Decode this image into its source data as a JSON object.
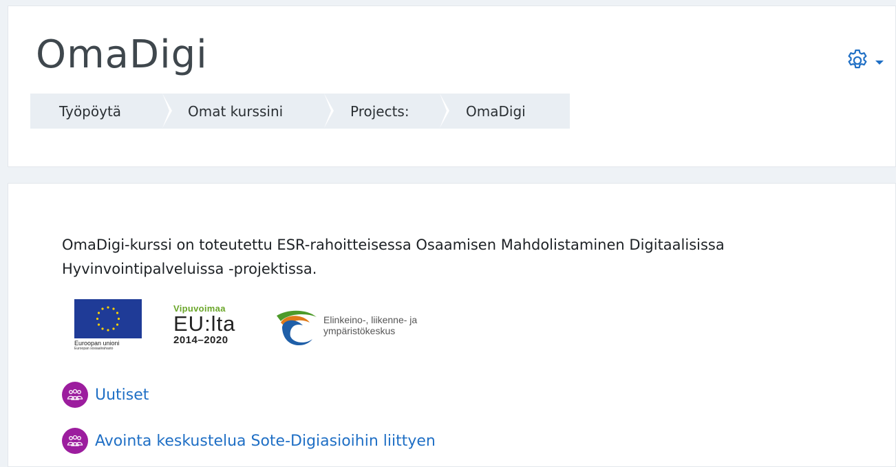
{
  "page": {
    "title": "OmaDigi"
  },
  "breadcrumb": {
    "items": [
      {
        "label": "Työpöytä"
      },
      {
        "label": "Omat kurssini"
      },
      {
        "label": "Projects:"
      },
      {
        "label": "OmaDigi"
      }
    ]
  },
  "settings": {
    "icon": "gear-icon",
    "caret_icon": "caret-down-icon",
    "accent_color": "#1f6fc5"
  },
  "main": {
    "description": "OmaDigi-kurssi on toteutettu ESR-rahoitteisessa Osaamisen Mahdolistaminen Digitaalisissa Hyvinvointipalveluissa -projektissa.",
    "logos": {
      "eu": {
        "name": "Euroopan unioni",
        "sub": "Euroopan sosiaalirahasto"
      },
      "vipuvoimaa": {
        "top": "Vipuvoimaa",
        "mid": "EU:lta",
        "bottom": "2014–2020"
      },
      "ely": {
        "line1": "Elinkeino-, liikenne- ja",
        "line2": "ympäristökeskus"
      }
    },
    "activities": [
      {
        "label": "Uutiset",
        "icon": "forum-icon"
      },
      {
        "label": "Avointa keskustelua Sote-Digiasioihin liittyen",
        "icon": "forum-icon"
      }
    ],
    "activity_icon_color": "#9c1d9e"
  }
}
